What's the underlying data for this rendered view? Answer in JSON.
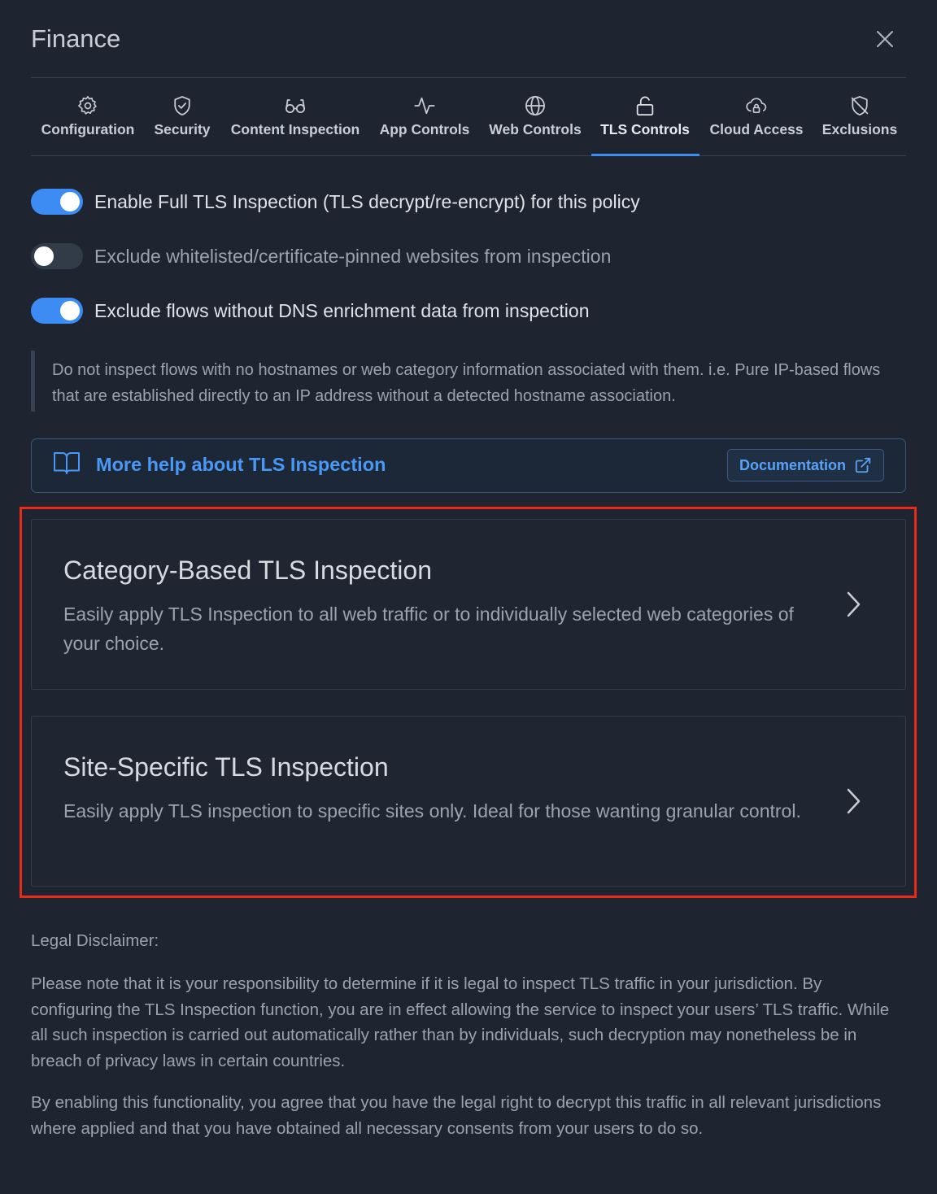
{
  "header": {
    "title": "Finance",
    "close_icon": "close-icon"
  },
  "tabs": [
    {
      "label": "Configuration",
      "icon": "gear-icon",
      "active": false
    },
    {
      "label": "Security",
      "icon": "shield-check-icon",
      "active": false
    },
    {
      "label": "Content Inspection",
      "icon": "glasses-icon",
      "active": false
    },
    {
      "label": "App Controls",
      "icon": "activity-icon",
      "active": false
    },
    {
      "label": "Web Controls",
      "icon": "globe-icon",
      "active": false
    },
    {
      "label": "TLS Controls",
      "icon": "unlock-icon",
      "active": true
    },
    {
      "label": "Cloud Access",
      "icon": "cloud-lock-icon",
      "active": false
    },
    {
      "label": "Exclusions",
      "icon": "shield-off-icon",
      "active": false
    }
  ],
  "toggles": [
    {
      "label": "Enable Full TLS Inspection (TLS decrypt/re-encrypt) for this policy",
      "on": true
    },
    {
      "label": "Exclude whitelisted/certificate-pinned websites from inspection",
      "on": false
    },
    {
      "label": "Exclude flows without DNS enrichment data from inspection",
      "on": true
    }
  ],
  "dns_note": "Do not inspect flows with no hostnames or web category information associated with them. i.e. Pure IP-based flows that are established directly to an IP address without a detected hostname association.",
  "help": {
    "text": "More help about TLS Inspection",
    "button": "Documentation",
    "icon": "book-open-icon",
    "button_icon": "external-link-icon"
  },
  "cards": [
    {
      "title": "Category-Based TLS Inspection",
      "description": "Easily apply TLS Inspection to all web traffic or to individually selected web categories of your choice.",
      "icon": "chevron-right-icon"
    },
    {
      "title": "Site-Specific TLS Inspection",
      "description": "Easily apply TLS inspection to specific sites only. Ideal for those wanting granular control.",
      "icon": "chevron-right-icon"
    }
  ],
  "disclaimer": {
    "title": "Legal Disclaimer:",
    "p1": "Please note that it is your responsibility to determine if it is legal to inspect TLS traffic in your jurisdiction. By configuring the TLS Inspection function, you are in effect allowing the service to inspect your users’ TLS traffic. While all such inspection is carried out automatically rather than by individuals, such decryption may nonetheless be in breach of privacy laws in certain countries.",
    "p2": "By enabling this functionality, you agree that you have the legal right to decrypt this traffic in all relevant jurisdictions where applied and that you have obtained all necessary consents from your users to do so."
  },
  "colors": {
    "background": "#1e2530",
    "accent": "#3d8cf4",
    "highlight": "#e82a17"
  }
}
